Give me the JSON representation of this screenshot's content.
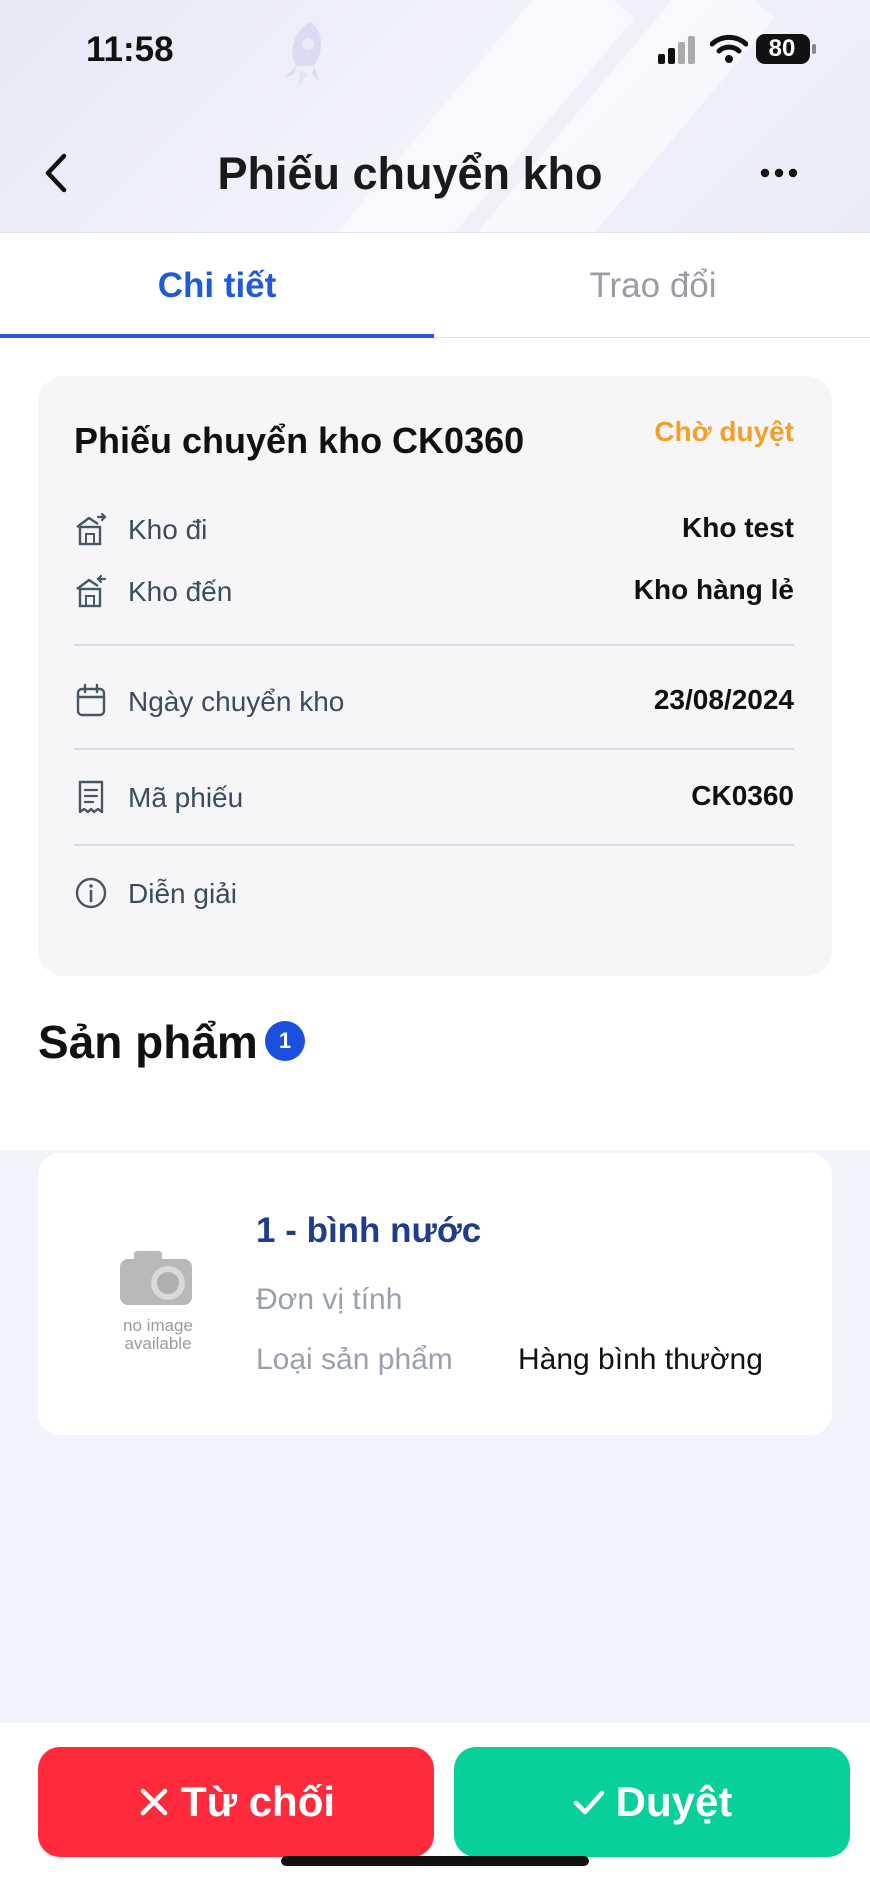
{
  "status_bar": {
    "time": "11:58",
    "battery": "80"
  },
  "header": {
    "title": "Phiếu chuyển kho"
  },
  "tabs": [
    {
      "label": "Chi tiết",
      "active": true
    },
    {
      "label": "Trao đổi",
      "active": false
    }
  ],
  "voucher": {
    "title": "Phiếu chuyển kho CK0360",
    "status": "Chờ duyệt",
    "rows": [
      {
        "icon": "warehouse-out-icon",
        "label": "Kho đi",
        "value": "Kho test"
      },
      {
        "icon": "warehouse-in-icon",
        "label": "Kho đến",
        "value": "Kho hàng lẻ"
      },
      {
        "icon": "calendar-icon",
        "label": "Ngày chuyển kho",
        "value": "23/08/2024"
      },
      {
        "icon": "receipt-icon",
        "label": "Mã phiếu",
        "value": "CK0360"
      },
      {
        "icon": "info-icon",
        "label": "Diễn giải",
        "value": ""
      }
    ]
  },
  "products": {
    "title": "Sản phẩm",
    "count": "1",
    "items": [
      {
        "name": "1 - bình nước",
        "image_text_line1": "no image",
        "image_text_line2": "available",
        "unit_label": "Đơn vị tính",
        "type_label": "Loại sản phẩm",
        "type_value": "Hàng bình thường"
      }
    ]
  },
  "actions": {
    "reject_label": "Từ chối",
    "approve_label": "Duyệt"
  },
  "colors": {
    "accent": "#1f5bd8",
    "status_pending": "#f3a02a",
    "reject": "#ff2a3c",
    "approve": "#07d09a"
  }
}
